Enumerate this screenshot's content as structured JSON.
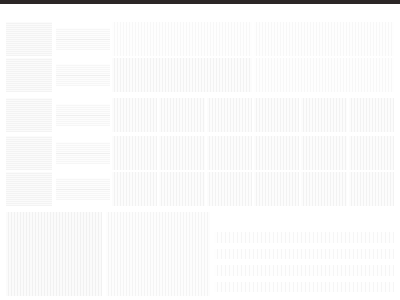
{
  "window": {
    "title_bar_color": "#2b2626"
  },
  "rows": [
    {
      "label": "",
      "field_value": "",
      "cells": 6
    },
    {
      "label": "",
      "field_value": "",
      "cells": 6
    },
    {
      "label": "",
      "field_value": "",
      "cells": 6
    },
    {
      "label": "",
      "field_value": "",
      "cells": 6
    },
    {
      "label": "",
      "field_value": "",
      "cells": 6
    }
  ],
  "bottom": {
    "left_text": "",
    "mid_text": "",
    "lines": [
      "",
      "",
      "",
      ""
    ]
  }
}
